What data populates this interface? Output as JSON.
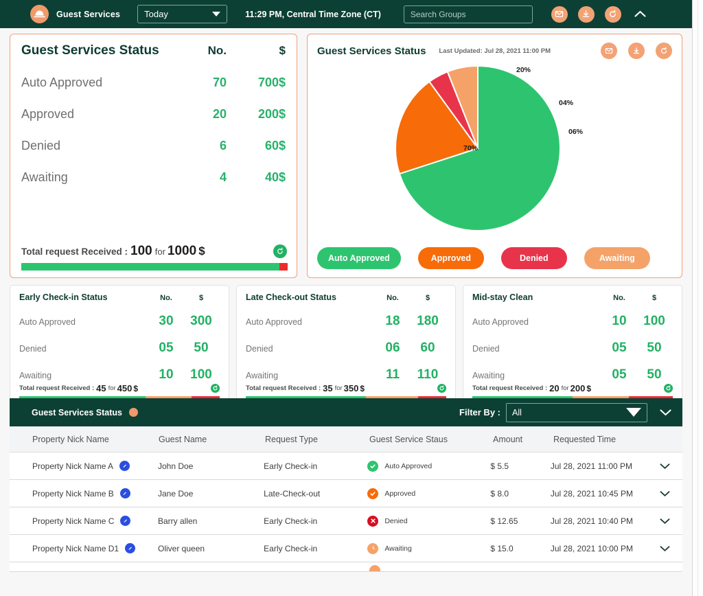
{
  "theme": {
    "dark_green": "#0d4034",
    "accent_orange": "#f0996a",
    "green": "#22b163",
    "orange": "#f76b09",
    "red": "#e8344a",
    "light_orange": "#f5a269"
  },
  "topbar": {
    "logo_icon": "cloche-logo-icon",
    "brand": "Guest Services",
    "period_select": {
      "value": "Today",
      "caret_icon": "chevron-down-icon"
    },
    "clock": "11:29 PM, Central Time Zone (CT)",
    "search": {
      "value": "",
      "placeholder": "Search Groups"
    },
    "icons": [
      {
        "name": "mail-icon",
        "glyph": "envelope"
      },
      {
        "name": "download-icon",
        "glyph": "download"
      },
      {
        "name": "refresh-icon",
        "glyph": "refresh"
      }
    ],
    "collapse_icon": "chevron-up-icon"
  },
  "status_card": {
    "title": "Guest Services Status",
    "col_no": "No.",
    "col_amount": "$",
    "rows": [
      {
        "label": "Auto Approved",
        "no": "70",
        "amount": "700$"
      },
      {
        "label": "Approved",
        "no": "20",
        "amount": "200$"
      },
      {
        "label": "Denied",
        "no": "6",
        "amount": "60$"
      },
      {
        "label": "Awaiting",
        "no": "4",
        "amount": "40$"
      }
    ],
    "total_prefix": "Total request Received :",
    "total_count": "100",
    "total_for": "for",
    "total_amount": "1000",
    "total_currency": "$",
    "refresh_icon": "refresh-icon",
    "progress": [
      {
        "color": "#2ec46f",
        "pct": 97
      },
      {
        "color": "#ee2b2b",
        "pct": 3
      }
    ]
  },
  "chart_card": {
    "title": "Guest Services Status",
    "last_updated": "Last Updated: Jul 28, 2021 11:00 PM",
    "icons": [
      {
        "name": "mail-icon",
        "glyph": "envelope"
      },
      {
        "name": "download-icon",
        "glyph": "download"
      },
      {
        "name": "refresh-icon",
        "glyph": "refresh"
      }
    ],
    "legend": [
      {
        "label": "Auto Approved",
        "color": "#2ec46f"
      },
      {
        "label": "Approved",
        "color": "#f76b09"
      },
      {
        "label": "Denied",
        "color": "#e8344a"
      },
      {
        "label": "Awaiting",
        "color": "#f5a269"
      }
    ]
  },
  "chart_data": {
    "type": "pie",
    "title": "Guest Services Status",
    "categories": [
      "Auto Approved",
      "Approved",
      "Denied",
      "Awaiting"
    ],
    "values": [
      70,
      20,
      4,
      6
    ],
    "labels": [
      "70%",
      "20%",
      "04%",
      "06%"
    ],
    "colors": [
      "#2ec46f",
      "#f76b09",
      "#e8344a",
      "#f5a269"
    ],
    "legend_position": "bottom",
    "grid": false
  },
  "mini_cards": [
    {
      "title": "Early Check-in Status",
      "col_no": "No.",
      "col_amount": "$",
      "rows": [
        {
          "label": "Auto Approved",
          "no": "30",
          "amount": "300"
        },
        {
          "label": "Denied",
          "no": "05",
          "amount": "50"
        },
        {
          "label": "Awaiting",
          "no": "10",
          "amount": "100"
        }
      ],
      "total_prefix": "Total request Received :",
      "total_count": "45",
      "total_for": "for",
      "total_amount": "450",
      "total_currency": "$",
      "refresh_icon": "refresh-icon",
      "progress": [
        {
          "color": "#2ec46f",
          "pct": 63
        },
        {
          "color": "#f5a269",
          "pct": 23
        },
        {
          "color": "#ee2b38",
          "pct": 14
        }
      ]
    },
    {
      "title": "Late Check-out Status",
      "col_no": "No.",
      "col_amount": "$",
      "rows": [
        {
          "label": "Auto Approved",
          "no": "18",
          "amount": "180"
        },
        {
          "label": "Denied",
          "no": "06",
          "amount": "60"
        },
        {
          "label": "Awaiting",
          "no": "11",
          "amount": "110"
        }
      ],
      "total_prefix": "Total request Received :",
      "total_count": "35",
      "total_for": "for",
      "total_amount": "350",
      "total_currency": "$",
      "refresh_icon": "refresh-icon",
      "progress": [
        {
          "color": "#2ec46f",
          "pct": 60
        },
        {
          "color": "#f5a269",
          "pct": 26
        },
        {
          "color": "#ee2b38",
          "pct": 14
        }
      ]
    },
    {
      "title": "Mid-stay Clean",
      "col_no": "No.",
      "col_amount": "$",
      "rows": [
        {
          "label": "Auto Approved",
          "no": "10",
          "amount": "100"
        },
        {
          "label": "Denied",
          "no": "05",
          "amount": "50"
        },
        {
          "label": "Awaiting",
          "no": "05",
          "amount": "50"
        }
      ],
      "total_prefix": "Total request Received :",
      "total_count": "20",
      "total_for": "for",
      "total_amount": "200",
      "total_currency": "$",
      "refresh_icon": "refresh-icon",
      "progress": [
        {
          "color": "#2ec46f",
          "pct": 50
        },
        {
          "color": "#f5a269",
          "pct": 28
        },
        {
          "color": "#ee2b38",
          "pct": 22
        }
      ]
    }
  ],
  "table": {
    "header": {
      "title": "Guest Services Status",
      "dot_icon": "status-dot-icon",
      "filter_label": "Filter By :",
      "filter_value": "All",
      "filter_caret_icon": "chevron-down-icon",
      "collapse_icon": "chevron-down-icon"
    },
    "columns": [
      "Property Nick Name",
      "Guest Name",
      "Request Type",
      "Guest Service Staus",
      "Amount",
      "Requested Time"
    ],
    "rows": [
      {
        "property": "Property Nick Name A",
        "guest": "John Doe",
        "request_type": "Early Check-in",
        "status": "Auto Approved",
        "status_color": "#2ec46f",
        "status_icon": "check-circle-icon",
        "amount": "$ 5.5",
        "requested_time": "Jul 28, 2021 11:00 PM",
        "edit_icon": "edit-badge-icon",
        "expand_icon": "chevron-down-icon"
      },
      {
        "property": "Property Nick Name B",
        "guest": "Jane Doe",
        "request_type": "Late-Check-out",
        "status": "Approved",
        "status_color": "#f76b09",
        "status_icon": "check-circle-icon",
        "amount": "$ 8.0",
        "requested_time": "Jul 28, 2021 10:45 PM",
        "edit_icon": "edit-badge-icon",
        "expand_icon": "chevron-down-icon"
      },
      {
        "property": "Property Nick Name C",
        "guest": "Barry allen",
        "request_type": "Early Check-in",
        "status": "Denied",
        "status_color": "#d80f20",
        "status_icon": "x-circle-icon",
        "amount": "$ 12.65",
        "requested_time": "Jul 28, 2021 10:40 PM",
        "edit_icon": "edit-badge-icon",
        "expand_icon": "chevron-down-icon"
      },
      {
        "property": "Property Nick Name D1",
        "guest": "Oliver queen",
        "request_type": "Early Check-in",
        "status": "Awaiting",
        "status_color": "#f5a269",
        "status_icon": "clock-circle-icon",
        "amount": "$ 15.0",
        "requested_time": "Jul 28, 2021 10:00 PM",
        "edit_icon": "edit-badge-icon",
        "expand_icon": "chevron-down-icon"
      }
    ]
  }
}
